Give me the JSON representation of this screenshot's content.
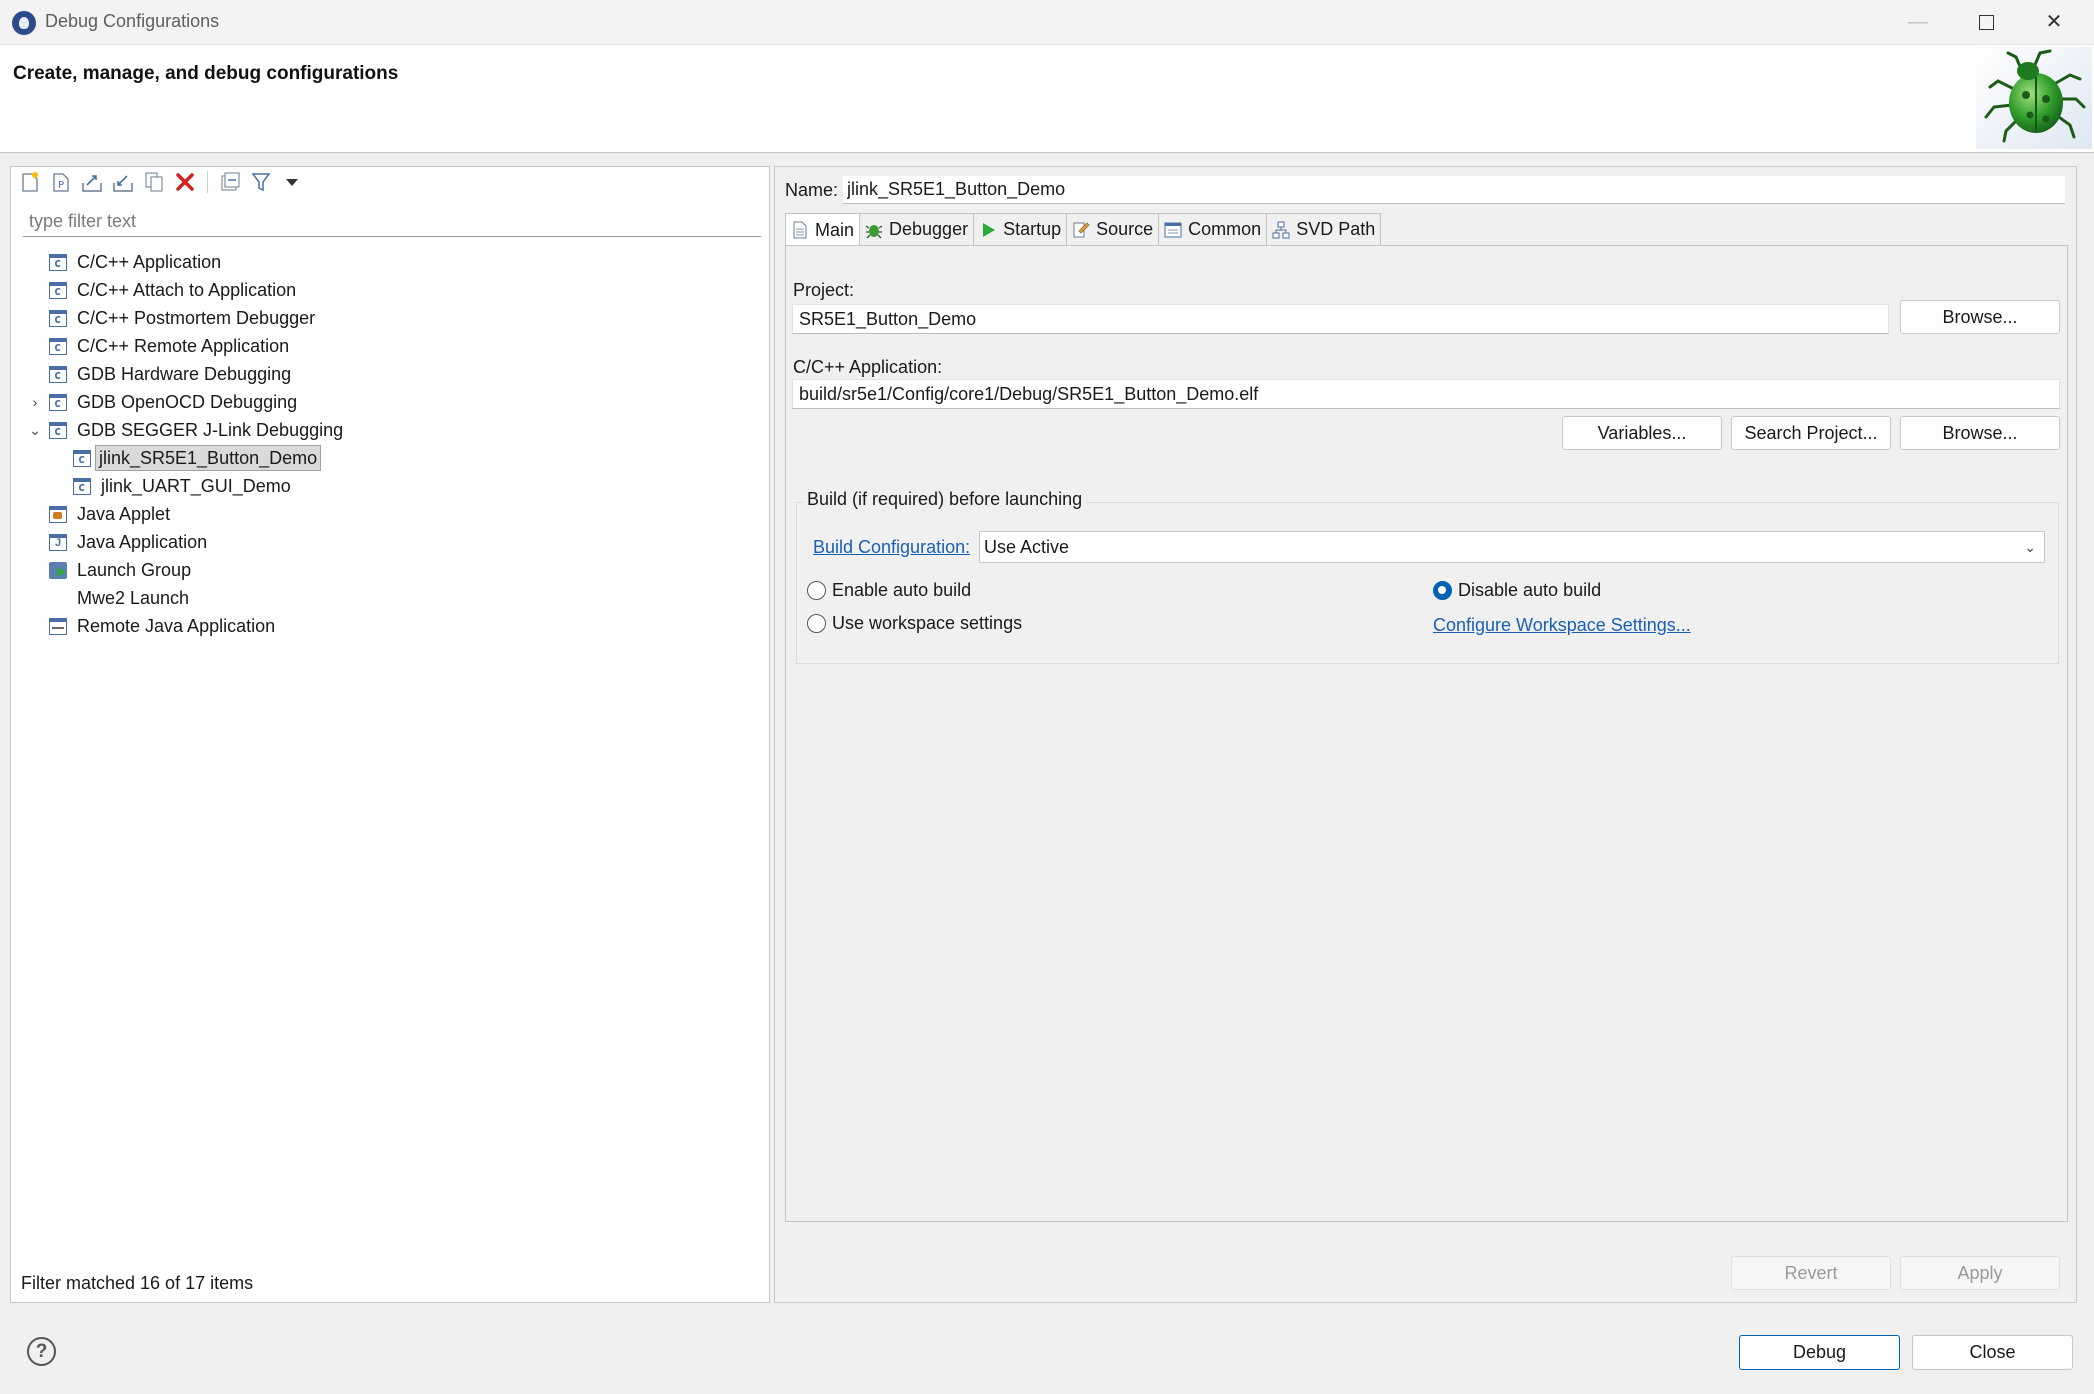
{
  "window": {
    "title": "Debug Configurations",
    "minimize_glyph": "—",
    "close_glyph": "✕"
  },
  "banner": {
    "title": "Create, manage, and debug configurations",
    "image": "bug-icon"
  },
  "left": {
    "toolbar": [
      "new-configuration-icon",
      "new-prototype-icon",
      "export-icon",
      "import-icon",
      "duplicate-icon",
      "delete-icon",
      "collapse-all-icon",
      "filter-icon",
      "view-menu-icon"
    ],
    "filter_placeholder": "type filter text",
    "tree": [
      {
        "label": "C/C++ Application",
        "icon": "cpp-config-icon"
      },
      {
        "label": "C/C++ Attach to Application",
        "icon": "cpp-config-icon"
      },
      {
        "label": "C/C++ Postmortem Debugger",
        "icon": "cpp-config-icon"
      },
      {
        "label": "C/C++ Remote Application",
        "icon": "cpp-config-icon"
      },
      {
        "label": "GDB Hardware Debugging",
        "icon": "cpp-config-icon"
      },
      {
        "label": "GDB OpenOCD Debugging",
        "icon": "cpp-config-icon",
        "expandable": true,
        "expanded": false
      },
      {
        "label": "GDB SEGGER J-Link Debugging",
        "icon": "cpp-config-icon",
        "expandable": true,
        "expanded": true
      },
      {
        "label": "jlink_SR5E1_Button_Demo",
        "icon": "cpp-config-icon",
        "child": true,
        "selected": true
      },
      {
        "label": "jlink_UART_GUI_Demo",
        "icon": "cpp-config-icon",
        "child": true
      },
      {
        "label": "Java Applet",
        "icon": "java-applet-icon"
      },
      {
        "label": "Java Application",
        "icon": "java-application-icon"
      },
      {
        "label": "Launch Group",
        "icon": "launch-group-icon"
      },
      {
        "label": "Mwe2 Launch",
        "icon": ""
      },
      {
        "label": "Remote Java Application",
        "icon": "remote-java-icon"
      }
    ],
    "status": "Filter matched 16 of 17 items"
  },
  "right": {
    "name_label": "Name:",
    "name_value": "jlink_SR5E1_Button_Demo",
    "tabs": [
      {
        "label": "Main",
        "icon": "main-tab-icon",
        "active": true
      },
      {
        "label": "Debugger",
        "icon": "debugger-tab-icon"
      },
      {
        "label": "Startup",
        "icon": "startup-tab-icon"
      },
      {
        "label": "Source",
        "icon": "source-tab-icon"
      },
      {
        "label": "Common",
        "icon": "common-tab-icon"
      },
      {
        "label": "SVD Path",
        "icon": "svd-path-tab-icon"
      }
    ],
    "project_label": "Project:",
    "project_value": "SR5E1_Button_Demo",
    "browse_label": "Browse...",
    "app_label": "C/C++ Application:",
    "app_value": "build/sr5e1/Config/core1/Debug/SR5E1_Button_Demo.elf",
    "variables_label": "Variables...",
    "search_project_label": "Search Project...",
    "browse2_label": "Browse...",
    "build_group_title": "Build (if required) before launching",
    "build_config_link": "Build Configuration:",
    "build_config_value": "Use Active",
    "enable_auto_build": "Enable auto build",
    "disable_auto_build": "Disable auto build",
    "use_workspace_settings": "Use workspace settings",
    "configure_workspace_link": "Configure Workspace Settings...",
    "selected_build_option": "Disable auto build",
    "revert_label": "Revert",
    "apply_label": "Apply"
  },
  "footer": {
    "help": "?",
    "debug_label": "Debug",
    "close_label": "Close"
  },
  "colors": {
    "accent": "#0063b1",
    "link": "#1a5fb4",
    "delete": "#d42020",
    "run_green": "#2eaa3a"
  }
}
